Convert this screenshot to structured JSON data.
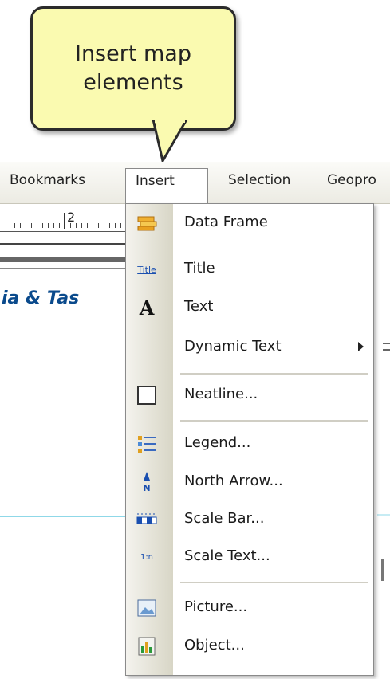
{
  "callout": {
    "line1": "Insert map",
    "line2": "elements"
  },
  "menubar": {
    "items": [
      "Bookmarks",
      "Insert",
      "Selection",
      "Geopro"
    ]
  },
  "background": {
    "ruler_number": "2",
    "title_fragment": "ia & Tas"
  },
  "menu": {
    "items": [
      {
        "label": "Data Frame",
        "icon": "data-frame-icon"
      },
      {
        "label": "Title",
        "icon": "title-icon",
        "icon_text": "Title"
      },
      {
        "label": "Text",
        "icon": "text-icon",
        "icon_text": "A"
      },
      {
        "label": "Dynamic Text",
        "icon": "none",
        "submenu": true
      },
      {
        "label": "Neatline...",
        "icon": "neatline-icon"
      },
      {
        "label": "Legend...",
        "icon": "legend-icon"
      },
      {
        "label": "North Arrow...",
        "icon": "north-arrow-icon",
        "icon_text": "N"
      },
      {
        "label": "Scale Bar...",
        "icon": "scale-bar-icon"
      },
      {
        "label": "Scale Text...",
        "icon": "scale-text-icon",
        "icon_text": "1:n"
      },
      {
        "label": "Picture...",
        "icon": "picture-icon"
      },
      {
        "label": "Object...",
        "icon": "object-icon"
      }
    ]
  }
}
